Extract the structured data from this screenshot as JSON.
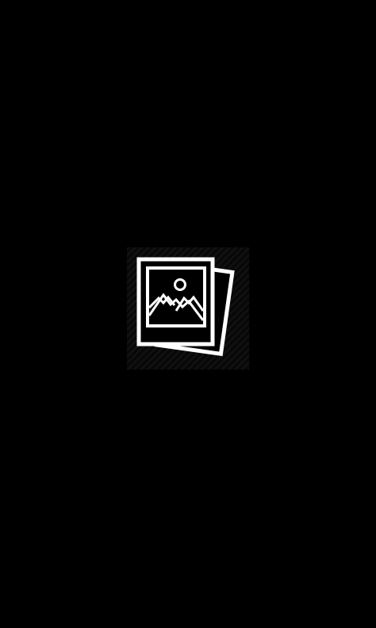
{
  "screen": {
    "background_color": "#000000",
    "icon": "photo-gallery-icon",
    "icon_color": "#ffffff",
    "tile_color": "#111111"
  }
}
